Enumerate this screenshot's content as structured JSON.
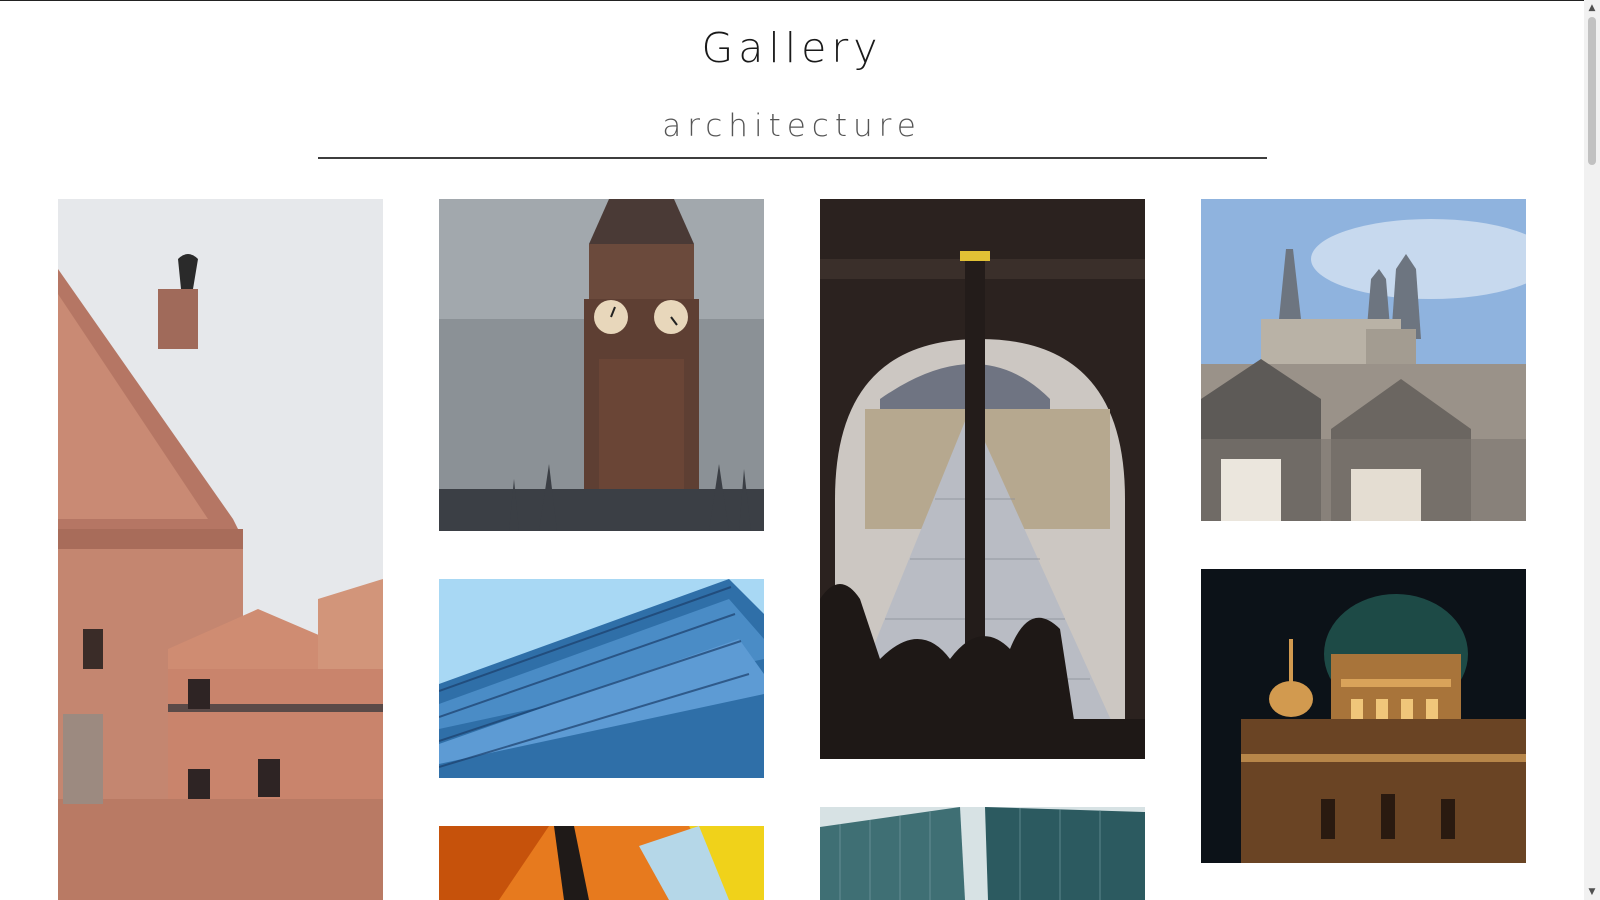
{
  "header": {
    "title": "Gallery",
    "subtitle": "architecture"
  },
  "gallery": {
    "photos": [
      {
        "subject": "baroque building facade with statue"
      },
      {
        "subject": "big ben clock tower"
      },
      {
        "subject": "louvre pyramid through arch"
      },
      {
        "subject": "gothic church over rooftops"
      },
      {
        "subject": "blue glass building facade"
      },
      {
        "subject": "domed cathedral at night"
      },
      {
        "subject": "orange and yellow abstract architecture"
      },
      {
        "subject": "glass skyscrapers looking up"
      }
    ]
  },
  "colors": {
    "text": "#1a1a1a",
    "subtitle": "#555555",
    "rule": "#3d3d3d"
  },
  "icons": {
    "scroll_up": "triangle-up",
    "scroll_down": "triangle-down"
  }
}
